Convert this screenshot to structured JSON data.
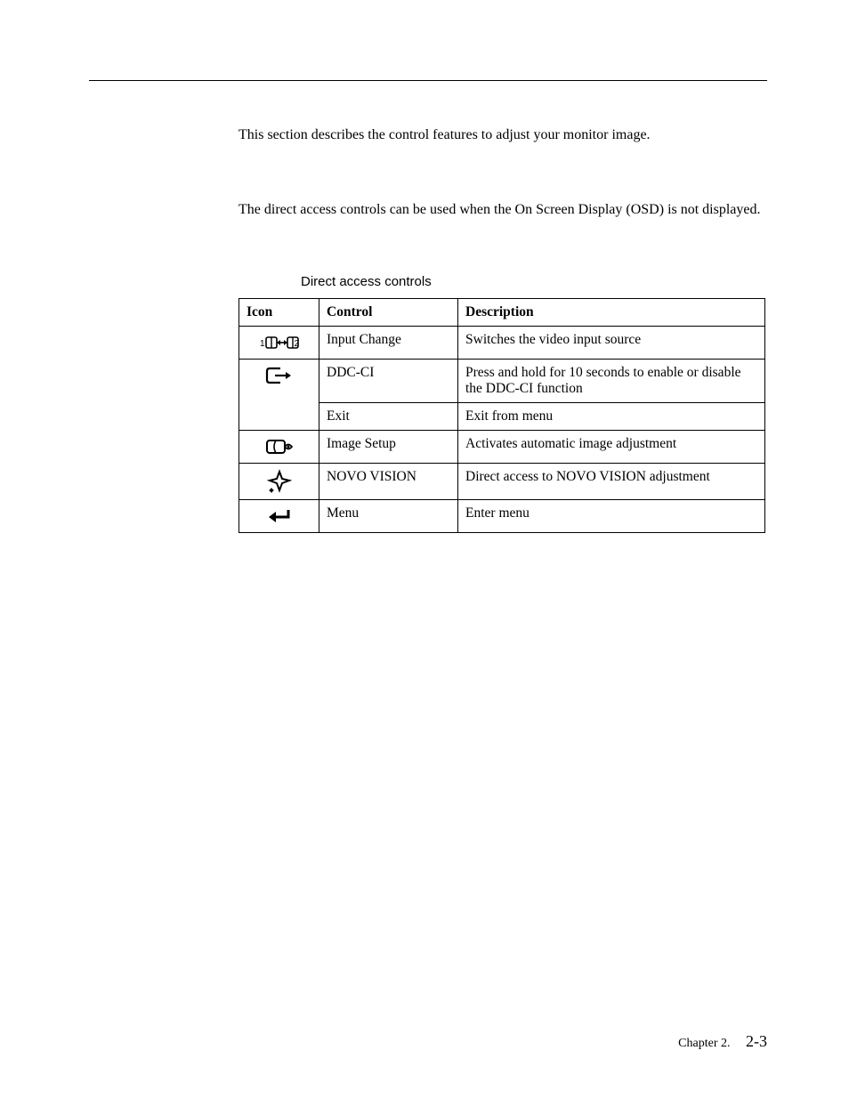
{
  "intro_text": "This section describes the control features to adjust your monitor image.",
  "direct_access_intro": "The direct access controls can be used when the On Screen Display (OSD) is not displayed.",
  "table": {
    "caption": "Direct access controls",
    "headers": {
      "icon": "Icon",
      "control": "Control",
      "description": "Description"
    },
    "rows": [
      {
        "icon": "input-change-icon",
        "control": "Input Change",
        "description": "Switches the video input source"
      },
      {
        "icon": "exit-arrow-icon",
        "control": "DDC-CI",
        "description": "Press and hold for 10 seconds to enable or disable the DDC-CI function"
      },
      {
        "icon": "",
        "control": "Exit",
        "description": "Exit from menu"
      },
      {
        "icon": "image-setup-icon",
        "control": "Image Setup",
        "description": "Activates automatic image adjustment"
      },
      {
        "icon": "novo-vision-icon",
        "control": "NOVO VISION",
        "description": "Direct access to NOVO VISION adjustment"
      },
      {
        "icon": "menu-enter-icon",
        "control": "Menu",
        "description": "Enter menu"
      }
    ]
  },
  "footer": {
    "chapter": "Chapter 2.",
    "page": "2-3"
  }
}
